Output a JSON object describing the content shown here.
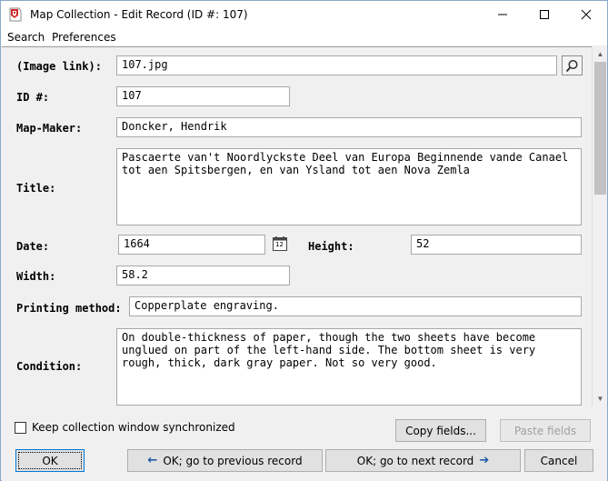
{
  "window": {
    "title": "Map Collection - Edit Record (ID #: 107)",
    "minimize_glyph": "—",
    "maximize_glyph": "☐",
    "close_glyph": "✕"
  },
  "menu": {
    "items": [
      {
        "label": "Search"
      },
      {
        "label": "Preferences"
      }
    ]
  },
  "form": {
    "image_link": {
      "label": "(Image link):",
      "value": "107.jpg"
    },
    "id": {
      "label": "ID #:",
      "value": "107"
    },
    "map_maker": {
      "label": "Map-Maker:",
      "value": "Doncker, Hendrik"
    },
    "title": {
      "label": "Title:",
      "value": "Pascaerte van't Noordlyckste Deel van Europa Beginnende vande Canael tot aen Spitsbergen, en van Ysland tot aen Nova Zemla"
    },
    "date": {
      "label": "Date:",
      "value": "1664",
      "calendar_day": "12"
    },
    "height": {
      "label": "Height:",
      "value": "52"
    },
    "width": {
      "label": "Width:",
      "value": "58.2"
    },
    "printing_method": {
      "label": "Printing method:",
      "value": "Copperplate engraving."
    },
    "condition": {
      "label": "Condition:",
      "value": "On double-thickness of paper, though the two sheets have become unglued on part of the left-hand side. The bottom sheet is very rough, thick, dark gray paper. Not so very good."
    }
  },
  "bottom": {
    "sync_checkbox_label": "Keep collection window synchronized",
    "sync_checked": false,
    "copy_fields": "Copy fields...",
    "paste_fields": "Paste fields",
    "ok": "OK",
    "prev": "OK; go to previous record",
    "next": "OK; go to next record",
    "cancel": "Cancel"
  },
  "colors": {
    "accent": "#0078d7",
    "arrow": "#1e5aa8",
    "app_icon": "#d22a2a"
  },
  "icons": {
    "search": "magnifier-icon",
    "calendar": "calendar-icon",
    "prev_arrow": "←",
    "next_arrow": "➔"
  }
}
